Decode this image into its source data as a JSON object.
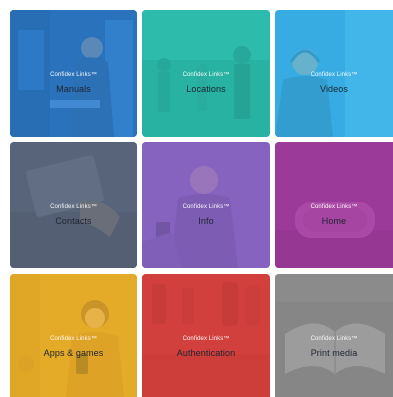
{
  "tiles": [
    {
      "brand": "Confidex Links™",
      "label": "Manuals",
      "color": "#2f7fd0",
      "scene": "man-at-machine"
    },
    {
      "brand": "Confidex Links™",
      "label": "Locations",
      "color": "#2bbfae",
      "scene": "people-walking"
    },
    {
      "brand": "Confidex Links™",
      "label": "Videos",
      "color": "#3bb2e6",
      "scene": "man-headphones"
    },
    {
      "brand": "Confidex Links™",
      "label": "Contacts",
      "color": "#5d6a7e",
      "scene": "tablet-hand"
    },
    {
      "brand": "Confidex Links™",
      "label": "Info",
      "color": "#8d6ac6",
      "scene": "man-phone"
    },
    {
      "brand": "Confidex Links™",
      "label": "Home",
      "color": "#a23fa0",
      "scene": "smart-speaker"
    },
    {
      "brand": "Confidex Links™",
      "label": "Apps & games",
      "color": "#e9b22e",
      "scene": "woman-phone"
    },
    {
      "brand": "Confidex Links™",
      "label": "Authentication",
      "color": "#d74743",
      "scene": "bottles"
    },
    {
      "brand": "Confidex Links™",
      "label": "Print media",
      "color": "#8b8b8b",
      "scene": "open-book"
    }
  ]
}
